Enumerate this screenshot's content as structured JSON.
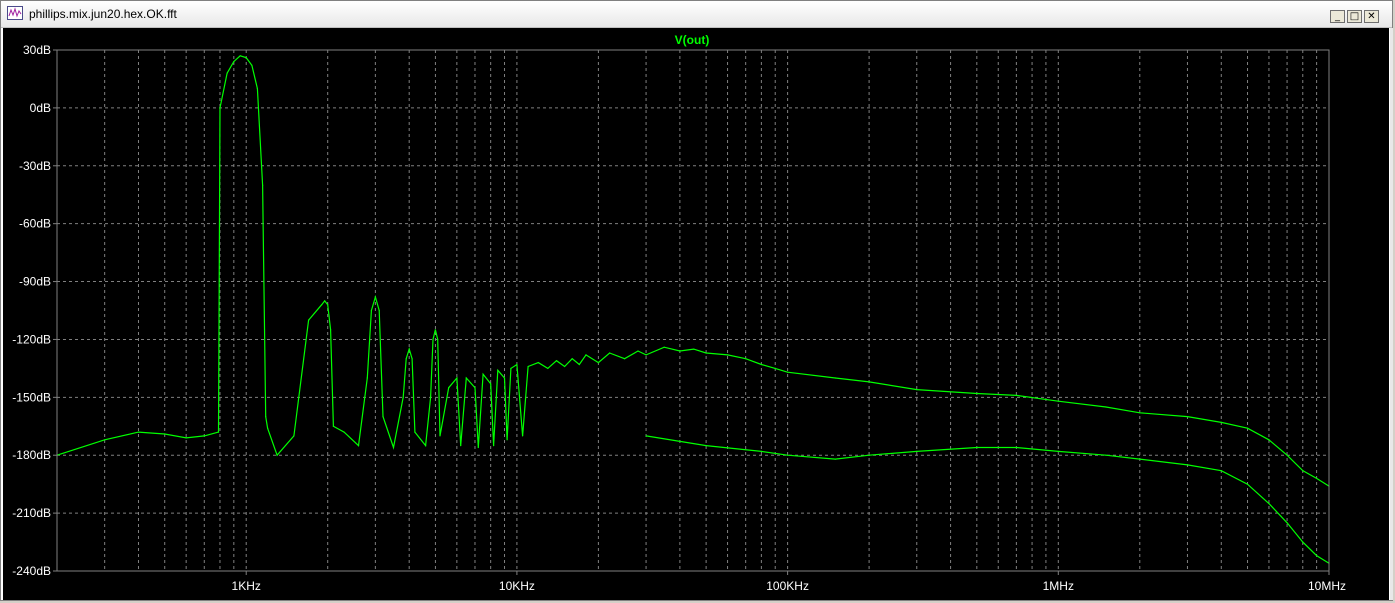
{
  "window": {
    "title": "phillips.mix.jun20.hex.OK.fft",
    "minimize_label": "_",
    "maximize_label": "□",
    "close_label": "✕",
    "icon": "waveform-icon"
  },
  "colors": {
    "background": "#000000",
    "trace": "#00ff00",
    "grid": "#808080",
    "text": "#ffffff"
  },
  "chart_data": {
    "type": "line",
    "title": "V(out)",
    "xlabel": "",
    "ylabel": "",
    "x_scale": "log",
    "xlim": [
      200,
      10000000
    ],
    "ylim": [
      -240,
      30
    ],
    "grid": true,
    "legend": "none",
    "y_ticks": [
      30,
      0,
      -30,
      -60,
      -90,
      -120,
      -150,
      -180,
      -210,
      -240
    ],
    "y_tick_labels": [
      "30dB",
      "0dB",
      "-30dB",
      "-60dB",
      "-90dB",
      "-120dB",
      "-150dB",
      "-180dB",
      "-210dB",
      "-240dB"
    ],
    "x_ticks": [
      1000,
      10000,
      100000,
      1000000,
      10000000
    ],
    "x_tick_labels": [
      "1KHz",
      "10KHz",
      "100KHz",
      "1MHz",
      "10MHz"
    ],
    "series": [
      {
        "color": "#00ff00",
        "x": [
          200,
          300,
          400,
          500,
          600,
          700,
          790,
          800,
          850,
          900,
          950,
          1000,
          1050,
          1100,
          1150,
          1180,
          1200,
          1300,
          1500,
          1700,
          1900,
          1950,
          2000,
          2050,
          2100,
          2300,
          2600,
          2800,
          2900,
          3000,
          3100,
          3200,
          3500,
          3800,
          3900,
          4000,
          4100,
          4200,
          4600,
          4800,
          4900,
          5000,
          5100,
          5200,
          5600,
          6000,
          6200,
          6500,
          7000,
          7200,
          7500,
          8000,
          8200,
          8500,
          9000,
          9200,
          9500,
          10000,
          10500,
          11000,
          12000,
          13000,
          14000,
          15000,
          16000,
          17000,
          18000,
          20000,
          22000,
          25000,
          28000,
          30000,
          35000,
          40000,
          45000,
          50000,
          60000,
          70000,
          80000,
          90000,
          100000,
          150000,
          200000,
          300000,
          500000,
          700000,
          1000000,
          1500000,
          2000000,
          3000000,
          4000000,
          5000000,
          6000000,
          7000000,
          8000000,
          9000000,
          10000000
        ],
        "y": [
          -180,
          -172,
          -168,
          -169,
          -171,
          -170,
          -168,
          0,
          18,
          24,
          27,
          26,
          22,
          10,
          -40,
          -160,
          -166,
          -180,
          -170,
          -110,
          -102,
          -100,
          -102,
          -115,
          -165,
          -168,
          -175,
          -140,
          -105,
          -98,
          -105,
          -160,
          -176,
          -150,
          -130,
          -125,
          -130,
          -168,
          -175,
          -150,
          -120,
          -115,
          -120,
          -170,
          -145,
          -140,
          -175,
          -140,
          -145,
          -176,
          -138,
          -143,
          -175,
          -136,
          -140,
          -172,
          -135,
          -133,
          -170,
          -134,
          -132,
          -135,
          -131,
          -134,
          -130,
          -133,
          -128,
          -132,
          -127,
          -130,
          -126,
          -128,
          -124,
          -126,
          -125,
          -127,
          -128,
          -130,
          -133,
          -135,
          -137,
          -140,
          -142,
          -146,
          -148,
          -149,
          -152,
          -155,
          -158,
          -160,
          -163,
          -166,
          -172,
          -180,
          -188,
          -192,
          -196
        ]
      },
      {
        "name": "",
        "color": "#00ff00",
        "x": [
          30000,
          50000,
          80000,
          100000,
          150000,
          200000,
          300000,
          500000,
          700000,
          1000000,
          1500000,
          2000000,
          3000000,
          4000000,
          5000000,
          6000000,
          7000000,
          8000000,
          9000000,
          10000000
        ],
        "y": [
          -170,
          -175,
          -178,
          -180,
          -182,
          -180,
          -178,
          -176,
          -176,
          -178,
          -180,
          -182,
          -185,
          -188,
          -195,
          -205,
          -215,
          -225,
          -232,
          -236
        ]
      }
    ]
  }
}
